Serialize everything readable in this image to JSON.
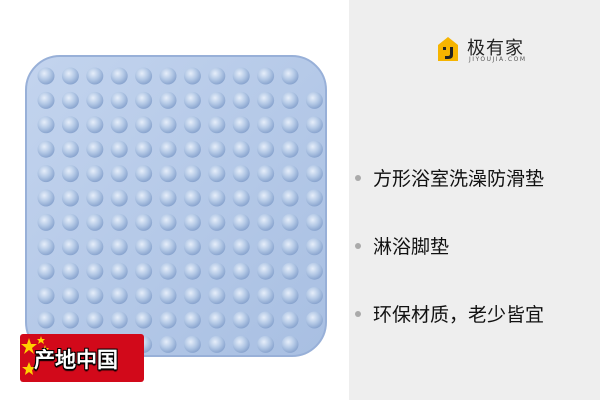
{
  "brand": {
    "name": "极有家",
    "sub": "JIYOUJIA.COM",
    "color": "#f6b400"
  },
  "product": {
    "image": "shower-mat-image",
    "mat_color": "#b6cbe8"
  },
  "features": [
    {
      "text": "方形浴室洗澡防滑垫"
    },
    {
      "text": "淋浴脚垫"
    },
    {
      "text": "环保材质，老少皆宜"
    }
  ],
  "origin": {
    "label": "产地中国",
    "badge_color": "#d2091a",
    "star_color": "#ffd200"
  }
}
